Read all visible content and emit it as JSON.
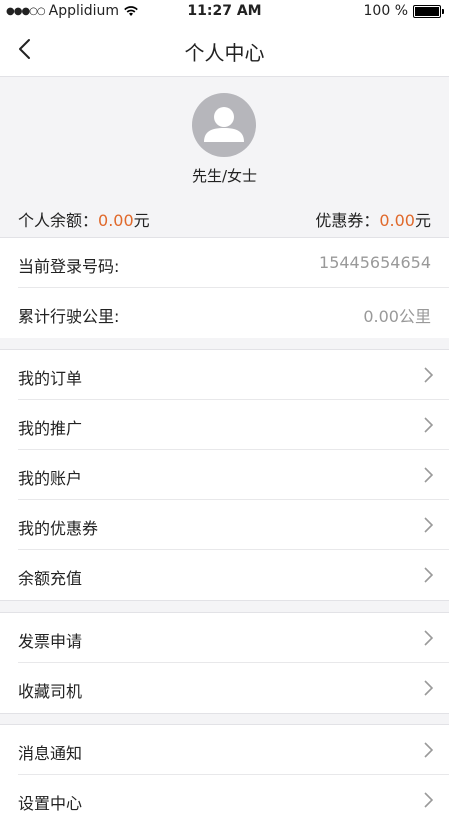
{
  "status_bar": {
    "signal_dots": "●●●○○",
    "carrier": "Applidium",
    "time": "11:27 AM",
    "battery_text": "100 %"
  },
  "nav": {
    "title": "个人中心",
    "back_icon": "chevron-left-icon"
  },
  "profile": {
    "avatar_icon": "person-icon",
    "nickname": "先生/女士",
    "balance_label": "个人余额：",
    "balance_value": "0.00",
    "balance_unit": "元",
    "coupon_label": "优惠券：",
    "coupon_value": "0.00",
    "coupon_unit": "元",
    "accent_color": "#e0692b"
  },
  "info": {
    "phone_label": "当前登录号码:",
    "phone_value": "15445654654",
    "mileage_label": "累计行驶公里:",
    "mileage_value": "0.00公里"
  },
  "menu_groups": [
    {
      "items": [
        {
          "label": "我的订单"
        },
        {
          "label": "我的推广"
        },
        {
          "label": "我的账户"
        },
        {
          "label": "我的优惠券"
        },
        {
          "label": "余额充值"
        }
      ]
    },
    {
      "items": [
        {
          "label": "发票申请"
        },
        {
          "label": "收藏司机"
        }
      ]
    },
    {
      "items": [
        {
          "label": "消息通知"
        },
        {
          "label": "设置中心"
        }
      ]
    }
  ]
}
